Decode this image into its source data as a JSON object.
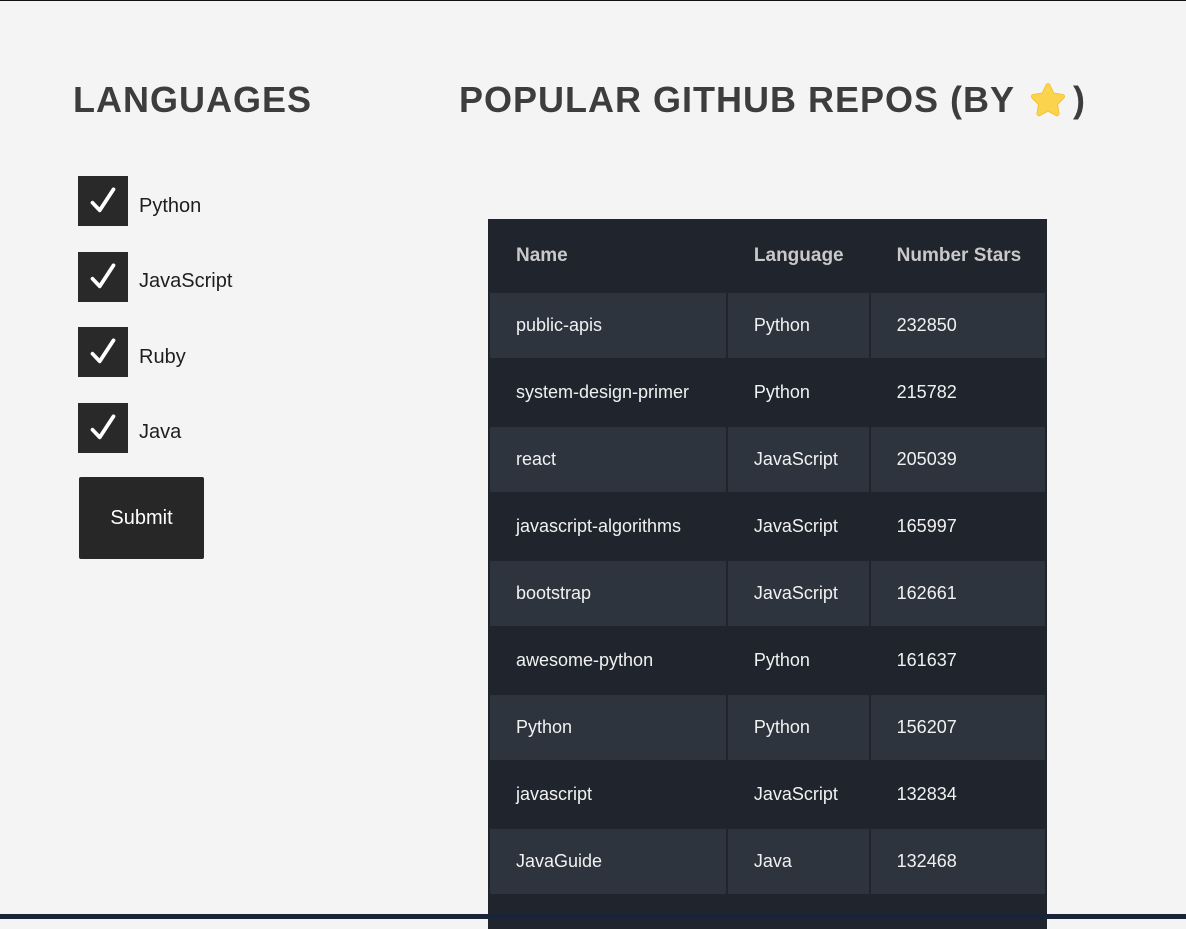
{
  "languages_panel": {
    "title": "LANGUAGES",
    "options": [
      {
        "label": "Python",
        "checked": true
      },
      {
        "label": "JavaScript",
        "checked": true
      },
      {
        "label": "Ruby",
        "checked": true
      },
      {
        "label": "Java",
        "checked": true
      }
    ],
    "submit_label": "Submit"
  },
  "repos_panel": {
    "title_prefix": "POPULAR GITHUB REPOS (BY",
    "title_icon": "star-icon",
    "title_suffix": ")",
    "columns": [
      "Name",
      "Language",
      "Number Stars"
    ],
    "rows": [
      {
        "name": "public-apis",
        "language": "Python",
        "stars": "232850"
      },
      {
        "name": "system-design-primer",
        "language": "Python",
        "stars": "215782"
      },
      {
        "name": "react",
        "language": "JavaScript",
        "stars": "205039"
      },
      {
        "name": "javascript-algorithms",
        "language": "JavaScript",
        "stars": "165997"
      },
      {
        "name": "bootstrap",
        "language": "JavaScript",
        "stars": "162661"
      },
      {
        "name": "awesome-python",
        "language": "Python",
        "stars": "161637"
      },
      {
        "name": "Python",
        "language": "Python",
        "stars": "156207"
      },
      {
        "name": "javascript",
        "language": "JavaScript",
        "stars": "132834"
      },
      {
        "name": "JavaGuide",
        "language": "Java",
        "stars": "132468"
      },
      {
        "name": "",
        "language": "",
        "stars": ""
      }
    ]
  },
  "colors": {
    "page_background": "#f4f4f4",
    "heading_text": "#3d3d3d",
    "checkbox_fill": "#292929",
    "button_fill": "#272727",
    "table_dark_row": "#1f242d",
    "table_light_row": "#2e343e",
    "star": "#fcd34d"
  }
}
